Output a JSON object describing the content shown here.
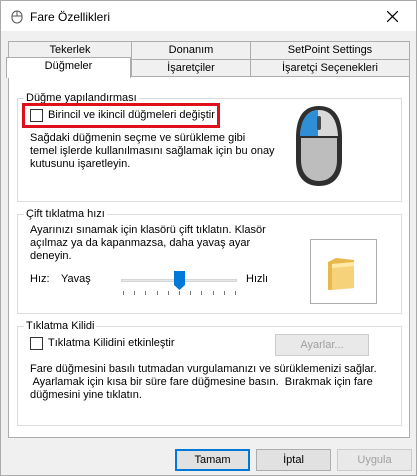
{
  "window": {
    "title": "Fare Özellikleri"
  },
  "tabs_row1": [
    {
      "label": "Tekerlek"
    },
    {
      "label": "Donanım"
    },
    {
      "label": "SetPoint Settings"
    }
  ],
  "tabs_row2": [
    {
      "label": "Düğmeler"
    },
    {
      "label": "İşaretçiler"
    },
    {
      "label": "İşaretçi Seçenekleri"
    }
  ],
  "button_config": {
    "title": "Düğme yapılandırması",
    "checkbox_label": "Birincil ve ikincil düğmeleri değiştir",
    "checked": false,
    "description_lines": [
      "Sağdaki düğmenin seçme ve sürükleme gibi",
      "temel işlerde kullanılmasını sağlamak için bu onay",
      "kutusunu işaretleyin."
    ]
  },
  "double_click": {
    "title": "Çift tıklatma hızı",
    "description_lines": [
      "Ayarınızı sınamak için klasörü çift tıklatın. Klasör",
      "açılmaz ya da kapanmazsa, daha yavaş ayar",
      "deneyin."
    ],
    "speed_label": "Hız:",
    "slow_label": "Yavaş",
    "fast_label": "Hızlı",
    "speed_fraction": 0.5
  },
  "click_lock": {
    "title": "Tıklatma Kilidi",
    "checkbox_label": "Tıklatma Kilidini etkinleştir",
    "checked": false,
    "settings_button": "Ayarlar...",
    "description_lines": [
      "Fare düğmesini basılı tutmadan vurgulamanızı ve sürüklemenizi sağlar.",
      " Ayarlamak için kısa bir süre fare düğmesine basın.  Bırakmak için fare",
      "düğmesini yine tıklatın."
    ]
  },
  "footer": {
    "ok": "Tamam",
    "cancel": "İptal",
    "apply": "Uygula"
  },
  "colors": {
    "highlight": "#e0101a",
    "mouse_accent": "#2e8fd6",
    "primary_border": "#0078d7"
  }
}
